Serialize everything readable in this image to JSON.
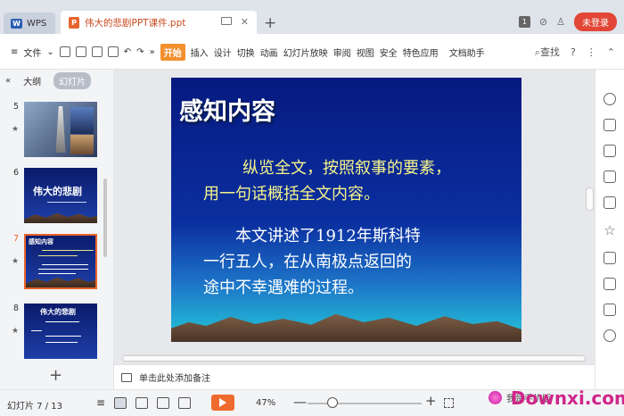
{
  "titlebar": {
    "app_tab": "WPS",
    "doc_tab": "伟大的悲剧PPT课件.ppt",
    "login_label": "未登录",
    "badge": "1"
  },
  "toolbar": {
    "file_menu": "文件",
    "more": "»",
    "menu_items": [
      "开始",
      "插入",
      "设计",
      "切换",
      "动画",
      "幻灯片放映",
      "审阅",
      "视图",
      "安全",
      "特色应用"
    ],
    "doc_assistant": "文档助手",
    "search": "查找",
    "help": "?",
    "more_dots": "⋮"
  },
  "panel": {
    "collapse": "«",
    "tab_outline": "大纲",
    "tab_slides": "幻灯片",
    "thumbnails": [
      {
        "num": "5",
        "title": ""
      },
      {
        "num": "6",
        "title": "伟大的悲剧"
      },
      {
        "num": "7",
        "title": "感知内容"
      },
      {
        "num": "8",
        "title": "伟大的悲剧"
      }
    ],
    "add": "+"
  },
  "slide": {
    "title": "感知内容",
    "para1_line1": "纵览全文，按照叙事的要素，",
    "para1_line2": "用一句话概括全文内容。",
    "para2_line1": "本文讲述了1912年斯科特",
    "para2_line2": "一行五人，在从南极点返回的",
    "para2_line3": "途中不幸遇难的过程。"
  },
  "notes": {
    "placeholder": "单击此处添加备注"
  },
  "status": {
    "slide_counter": "幻灯片 7 / 13",
    "zoom": "47%",
    "zoom_minus": "—",
    "zoom_plus": "+"
  },
  "watermark": {
    "text": "Downxi.com",
    "sub": "我是手机版"
  },
  "colors": {
    "accent": "#e8642c",
    "login": "#e24636",
    "slide_bg": "#0b2fa0",
    "slide_text_yellow": "#f6f48a"
  }
}
